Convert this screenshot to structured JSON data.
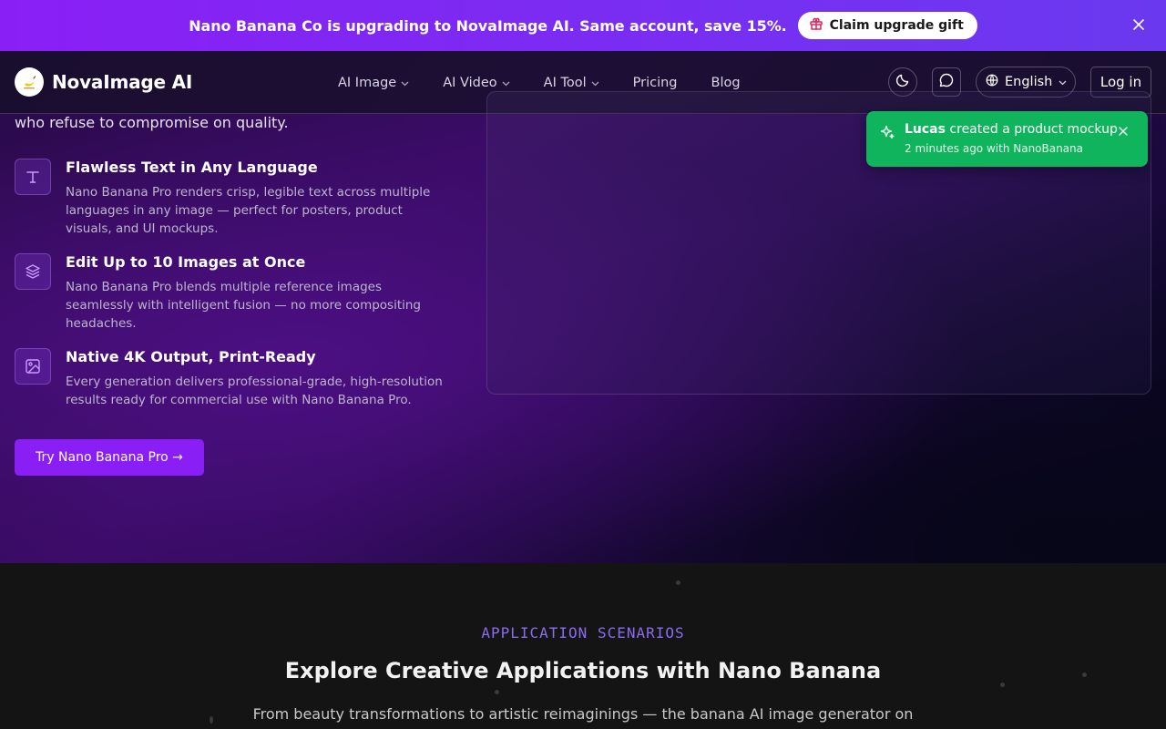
{
  "banner": {
    "message": "Nano Banana Co is upgrading to NovaImage AI. Same account, save 15%.",
    "button_label": "Claim upgrade gift",
    "button_icon": "gift-icon",
    "close_icon": "close-icon"
  },
  "nav": {
    "brand": "NovaImage AI",
    "links": [
      {
        "label": "AI Image",
        "dropdown": true
      },
      {
        "label": "AI Video",
        "dropdown": true
      },
      {
        "label": "AI Tool",
        "dropdown": true
      },
      {
        "label": "Pricing",
        "dropdown": false
      },
      {
        "label": "Blog",
        "dropdown": false
      }
    ],
    "theme_icon": "moon-icon",
    "chat_icon": "chat-bubble-icon",
    "language": "English",
    "login_label": "Log in"
  },
  "hero": {
    "tagline": "who refuse to compromise on quality.",
    "features": [
      {
        "icon": "text-icon",
        "title": "Flawless Text in Any Language",
        "description": "Nano Banana Pro renders crisp, legible text across multiple languages in any image — perfect for posters, product visuals, and UI mockups."
      },
      {
        "icon": "layers-icon",
        "title": "Edit Up to 10 Images at Once",
        "description": "Nano Banana Pro blends multiple reference images seamlessly with intelligent fusion — no more compositing headaches."
      },
      {
        "icon": "image-icon",
        "title": "Native 4K Output, Print-Ready",
        "description": "Every generation delivers professional-grade, high-resolution results ready for commercial use with Nano Banana Pro."
      }
    ],
    "cta_label": "Try Nano Banana Pro →"
  },
  "toast": {
    "user": "Lucas",
    "action": "created a product mockup",
    "meta": "2 minutes ago with NanoBanana",
    "icon": "sparkle-icon"
  },
  "scenarios": {
    "eyebrow": "APPLICATION SCENARIOS",
    "title": "Explore Creative Applications with Nano Banana",
    "subtitle": "From beauty transformations to artistic reimaginings — the banana AI image generator on"
  },
  "colors": {
    "accent": "#8a1ff5",
    "toast": "#0fb45c",
    "eyebrow": "#8b6cf0"
  }
}
